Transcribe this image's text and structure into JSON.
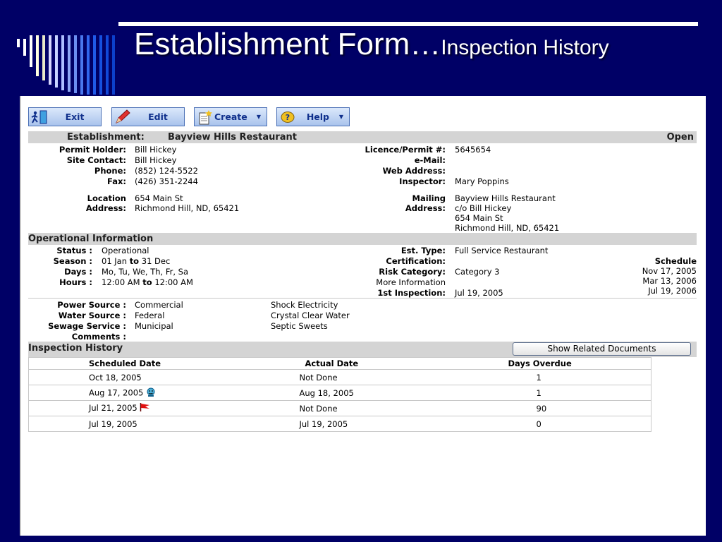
{
  "slide": {
    "title_main": "Establishment Form…",
    "title_sub": "Inspection History"
  },
  "toolbar": {
    "exit_label": "Exit",
    "edit_label": "Edit",
    "create_label": "Create",
    "help_label": "Help"
  },
  "establishment": {
    "header_label": "Establishment:",
    "name": "Bayview Hills Restaurant",
    "status": "Open",
    "permit_holder_label": "Permit Holder:",
    "permit_holder": "Bill Hickey",
    "site_contact_label": "Site Contact:",
    "site_contact": "Bill Hickey",
    "phone_label": "Phone:",
    "phone": "(852) 124-5522",
    "fax_label": "Fax:",
    "fax": "(426) 351-2244",
    "licence_label": "Licence/Permit #:",
    "licence": "5645654",
    "email_label": "e-Mail:",
    "email": "",
    "web_label": "Web Address:",
    "web": "",
    "inspector_label": "Inspector:",
    "inspector": "Mary Poppins",
    "location_label_1": "Location",
    "location_label_2": "Address:",
    "location_1": "654 Main St",
    "location_2": "Richmond Hill, ND, 65421",
    "mailing_label_1": "Mailing",
    "mailing_label_2": "Address:",
    "mailing_1": "Bayview Hills Restaurant",
    "mailing_2": "c/o Bill Hickey",
    "mailing_3": "654 Main St",
    "mailing_4": "Richmond Hill, ND, 65421"
  },
  "operational": {
    "header": "Operational Information",
    "status_label": "Status :",
    "status": "Operational",
    "season_label": "Season :",
    "season_from": "01 Jan",
    "season_to_word": "to",
    "season_to": "31 Dec",
    "days_label": "Days :",
    "days": "Mo, Tu, We, Th, Fr, Sa",
    "hours_label": "Hours :",
    "hours_from": "12:00 AM",
    "hours_to_word": "to",
    "hours_to": "12:00 AM",
    "est_type_label": "Est. Type:",
    "est_type": "Full Service Restaurant",
    "cert_label": "Certification:",
    "cert": "",
    "risk_label": "Risk Category:",
    "risk": "Category 3",
    "more_info": "More Information",
    "first_insp_label": "1st Inspection:",
    "first_insp": "Jul 19, 2005",
    "schedule_label": "Schedule",
    "schedule": [
      "Nov 17, 2005",
      "Mar 13, 2006",
      "Jul 19, 2006"
    ],
    "power_label": "Power Source :",
    "power": "Commercial",
    "power_provider": "Shock Electricity",
    "water_label": "Water Source :",
    "water": "Federal",
    "water_provider": "Crystal Clear Water",
    "sewage_label": "Sewage Service :",
    "sewage": "Municipal",
    "sewage_provider": "Septic Sweets",
    "comments_label": "Comments :",
    "comments": ""
  },
  "history": {
    "header": "Inspection History",
    "show_docs_label": "Show Related Documents",
    "columns": [
      "Scheduled Date",
      "Actual Date",
      "Days Overdue"
    ],
    "rows": [
      {
        "scheduled": "Oct 18, 2005",
        "actual": "Not Done",
        "overdue": "1",
        "icon": ""
      },
      {
        "scheduled": "Aug 17, 2005",
        "actual": "Aug 18, 2005",
        "overdue": "1",
        "icon": "face-icon"
      },
      {
        "scheduled": "Jul 21, 2005",
        "actual": "Not Done",
        "overdue": "90",
        "icon": "red-flag-icon"
      },
      {
        "scheduled": "Jul 19, 2005",
        "actual": "Jul 19, 2005",
        "overdue": "0",
        "icon": ""
      }
    ]
  },
  "colors": {
    "slide_bg": "#000066",
    "button_text": "#10308c",
    "section_bg": "#d4d4d4"
  }
}
